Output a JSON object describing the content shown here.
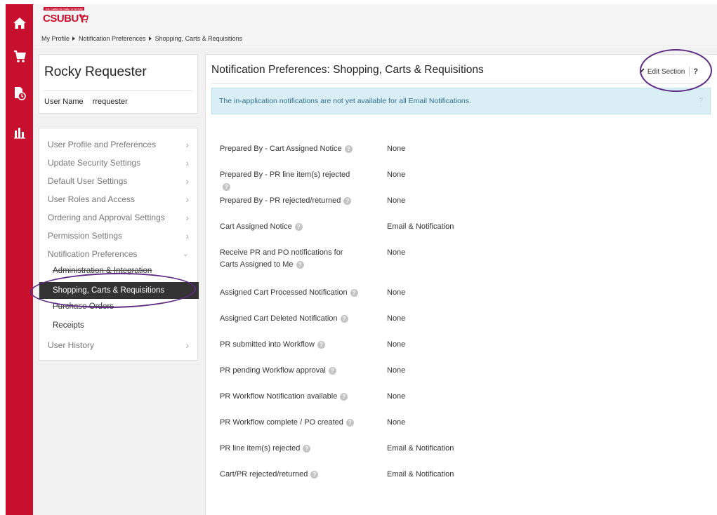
{
  "brand": {
    "logo_text": "CSUBUY",
    "tagline": "The California State University",
    "accent_color": "#c8102e"
  },
  "rail": {
    "icons": [
      "home-icon",
      "cart-icon",
      "document-clock-icon",
      "bar-chart-icon"
    ]
  },
  "breadcrumb": [
    "My Profile",
    "Notification Preferences",
    "Shopping, Carts & Requisitions"
  ],
  "profile": {
    "name": "Rocky Requester",
    "username_label": "User Name",
    "username": "rrequester"
  },
  "nav": {
    "items": [
      {
        "label": "User Profile and Preferences"
      },
      {
        "label": "Update Security Settings"
      },
      {
        "label": "Default User Settings"
      },
      {
        "label": "User Roles and Access"
      },
      {
        "label": "Ordering and Approval Settings"
      },
      {
        "label": "Permission Settings"
      },
      {
        "label": "Notification Preferences"
      }
    ],
    "subitems": [
      {
        "label": "Administration & Integration"
      },
      {
        "label": "Shopping, Carts & Requisitions"
      },
      {
        "label": "Purchase Orders"
      },
      {
        "label": "Receipts"
      }
    ],
    "history": "User History"
  },
  "main": {
    "title": "Notification Preferences:  Shopping, Carts & Requisitions",
    "edit_label": "Edit Section",
    "help_label": "?",
    "alert": "The in-application notifications are not yet available for all Email Notifications.",
    "alert_help": "?",
    "rows": [
      {
        "label": "Prepared By - Cart Assigned Notice",
        "value": "None"
      },
      {
        "label": "Prepared By - PR line item(s) rejected",
        "value": "None"
      },
      {
        "label": "Prepared By - PR rejected/returned",
        "value": "None"
      },
      {
        "label": "Cart Assigned Notice",
        "value": "Email & Notification"
      },
      {
        "label": "Receive PR and PO notifications for Carts Assigned to Me",
        "value": "None"
      },
      {
        "label": "Assigned Cart Processed Notification",
        "value": "None"
      },
      {
        "label": "Assigned Cart Deleted Notification",
        "value": "None"
      },
      {
        "label": "PR submitted into Workflow",
        "value": "None"
      },
      {
        "label": "PR pending Workflow approval",
        "value": "None"
      },
      {
        "label": "PR Workflow Notification available",
        "value": "None"
      },
      {
        "label": "PR Workflow complete / PO created",
        "value": "None"
      },
      {
        "label": "PR line item(s) rejected",
        "value": "Email & Notification"
      },
      {
        "label": "Cart/PR rejected/returned",
        "value": "Email & Notification"
      }
    ]
  }
}
